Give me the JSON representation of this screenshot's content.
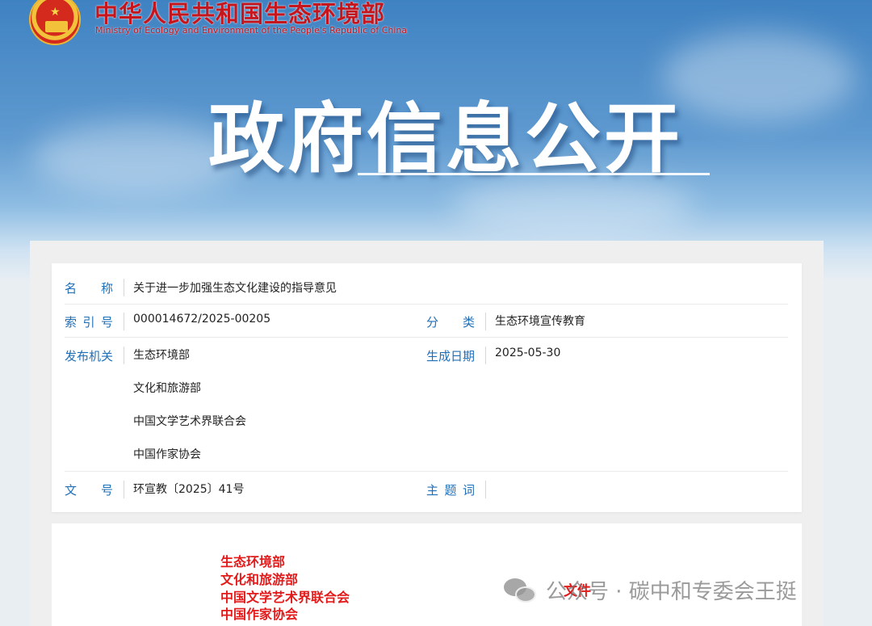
{
  "header": {
    "ministry_cn": "中华人民共和国生态环境部",
    "ministry_en": "Ministry of Ecology and Environment of the People's Republic of China",
    "banner_title": "政府信息公开"
  },
  "meta": {
    "name_label": "名　　称",
    "name_value": "关于进一步加强生态文化建设的指导意见",
    "index_label": "索引号",
    "index_value": "000014672/2025-00205",
    "category_label": "分　　类",
    "category_value": "生态环境宣传教育",
    "issuer_label": "发布机关",
    "issuers": [
      "生态环境部",
      "文化和旅游部",
      "中国文学艺术界联合会",
      "中国作家协会"
    ],
    "date_label": "生成日期",
    "date_value": "2025-05-30",
    "docno_label": "文　　号",
    "docno_value": "环宣教〔2025〕41号",
    "keywords_label": "主题词",
    "keywords_value": ""
  },
  "document": {
    "issuers": [
      "生态环境部",
      "文化和旅游部",
      "中国文学艺术界联合会",
      "中国作家协会"
    ],
    "doc_word": "文件"
  },
  "watermark": {
    "text": "公众号 · 碳中和专委会王挺",
    "icon": "wechat-icon"
  },
  "colors": {
    "label_blue": "#1f6fb8",
    "red_title": "#c6161d",
    "doc_red": "#e21a1a"
  }
}
